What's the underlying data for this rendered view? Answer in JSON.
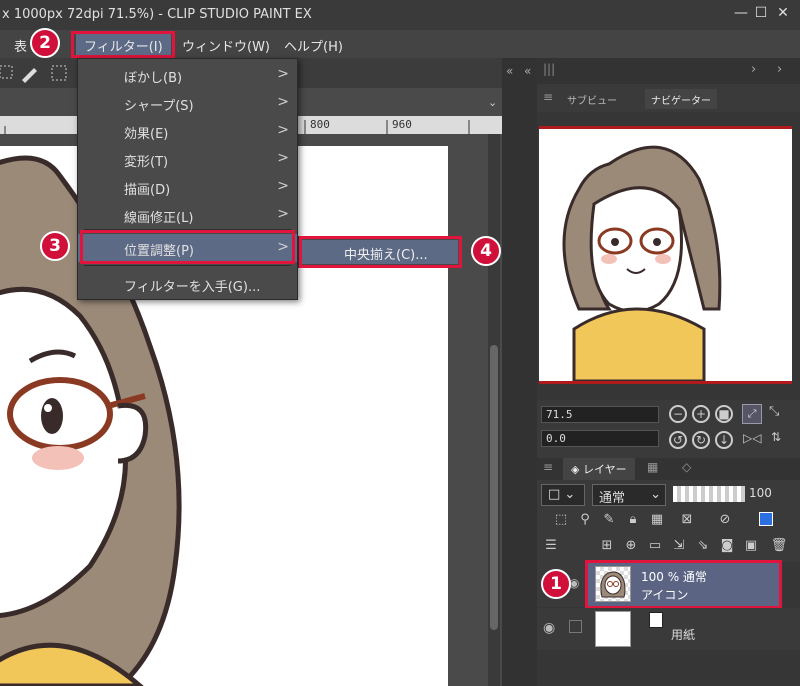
{
  "window": {
    "title": "x 1000px 72dpi 71.5%)  - CLIP STUDIO PAINT EX",
    "minimize": "—",
    "maximize": "☐",
    "close": "✕"
  },
  "menubar": {
    "partial_item": "表",
    "filter": "フィルター(I)",
    "window": "ウィンドウ(W)",
    "help": "ヘルプ(H)"
  },
  "filter_menu": {
    "items": [
      {
        "label": "ぼかし(B)",
        "submenu": true
      },
      {
        "label": "シャープ(S)",
        "submenu": true
      },
      {
        "label": "効果(E)",
        "submenu": true
      },
      {
        "label": "変形(T)",
        "submenu": true
      },
      {
        "label": "描画(D)",
        "submenu": true
      },
      {
        "label": "線画修正(L)",
        "submenu": true
      },
      {
        "label": "位置調整(P)",
        "submenu": true,
        "highlighted": true
      },
      {
        "label": "フィルターを入手(G)...",
        "submenu": false
      }
    ],
    "arrow": ">"
  },
  "submenu": {
    "item": "中央揃え(C)..."
  },
  "ruler": {
    "tick1": "800",
    "tick2": "960"
  },
  "badges": {
    "b1": "1",
    "b2": "2",
    "b3": "3",
    "b4": "4"
  },
  "navigator": {
    "tab_subview": "サブビュー",
    "tab_navigator": "ナビゲーター",
    "zoom_value": "71.5",
    "rotate_value": "0.0"
  },
  "layer_panel": {
    "tab_label": "レイヤー",
    "blend_mode": "通常",
    "opacity": "100",
    "layers": [
      {
        "line1": "100 % 通常",
        "line2": "アイコン",
        "selected": true
      },
      {
        "line1": "",
        "line2": "用紙",
        "selected": false
      }
    ]
  },
  "colors": {
    "highlight": "#5d6a86",
    "annotation_red": "#e0143c",
    "selected_layer": "#5b6583"
  }
}
